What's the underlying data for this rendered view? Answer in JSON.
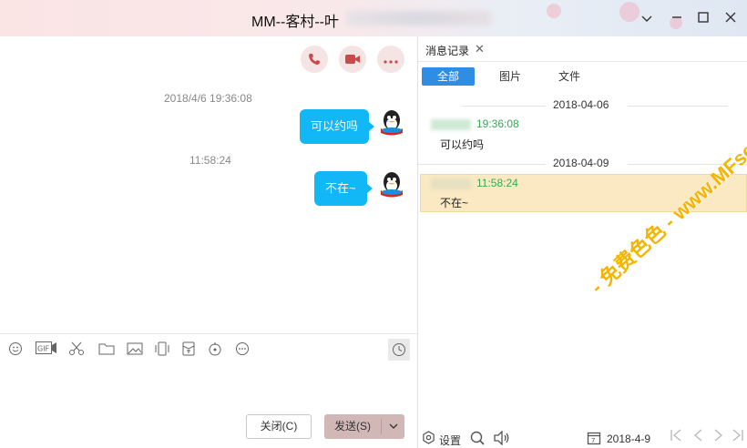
{
  "window": {
    "title": "MM--客村--叶",
    "controls": [
      "chevron-down-icon",
      "minimize-icon",
      "maximize-icon",
      "close-icon"
    ]
  },
  "chat": {
    "actions": [
      "phone-call-icon",
      "video-call-icon",
      "more-icon"
    ],
    "messages": [
      {
        "timestamp": "2018/4/6 19:36:08",
        "text": "可以约吗"
      },
      {
        "timestamp": "11:58:24",
        "text": "不在~"
      }
    ],
    "toolbar": [
      "emoji-icon",
      "gif-icon",
      "scissors-icon",
      "folder-icon",
      "image-icon",
      "shake-icon",
      "red-packet-icon",
      "music-icon",
      "more-icon"
    ],
    "buttons": {
      "close": "关闭(C)",
      "send": "发送(S)"
    }
  },
  "history": {
    "tab_label": "消息记录",
    "filters": [
      "全部",
      "图片",
      "文件"
    ],
    "active_filter": "全部",
    "groups": [
      {
        "date": "2018-04-06",
        "time": "19:36:08",
        "sender_fragment": "",
        "text": "可以约吗"
      },
      {
        "date": "2018-04-09",
        "time": "11:58:24",
        "sender_fragment": "",
        "text": "不在~"
      }
    ],
    "footer": {
      "settings": "设置",
      "date": "2018-4-9"
    }
  },
  "watermark": "- 免费色色 - www.MFsese.com",
  "colors": {
    "bubble": "#12b7f5",
    "filter_active": "#2f8de4",
    "highlight": "#fbe9c3",
    "sender_time": "#3aa757",
    "watermark": "#f5b400"
  }
}
